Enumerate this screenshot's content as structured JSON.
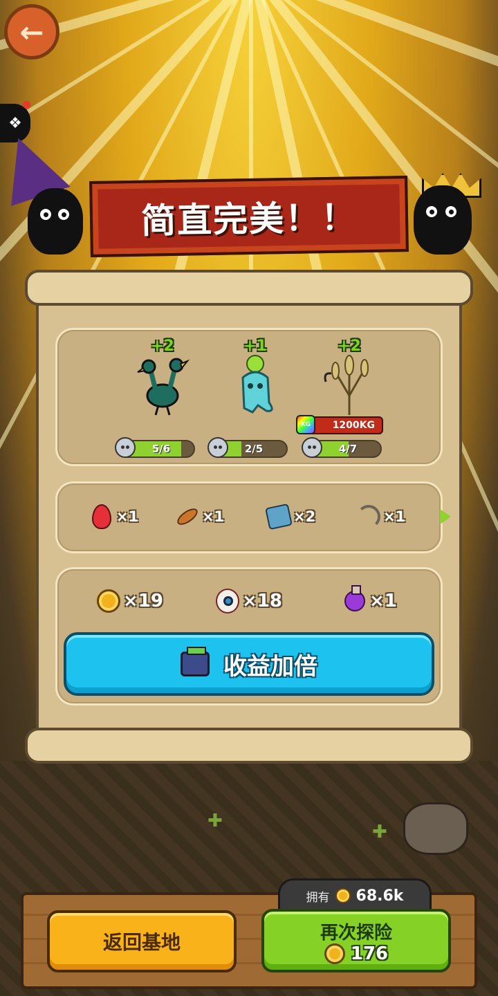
{
  "banner": {
    "title": "简直完美！！"
  },
  "monsters": [
    {
      "name": "ostrich",
      "plus": "+2",
      "progress": "5/6",
      "fill": 0.83,
      "color": "#1f6d5e"
    },
    {
      "name": "ghost-radish",
      "plus": "+1",
      "progress": "2/5",
      "fill": 0.4,
      "color": "#5fd3d8"
    },
    {
      "name": "wheat-plant",
      "plus": "+2",
      "progress": "4/7",
      "fill": 0.57,
      "color": "#b8a46a",
      "weight": "1200KG",
      "weight_tag": "KG"
    }
  ],
  "loot": [
    {
      "icon": "red-egg-icon",
      "qty": "×1"
    },
    {
      "icon": "feather-icon",
      "qty": "×1"
    },
    {
      "icon": "ticket-icon",
      "qty": "×2"
    },
    {
      "icon": "worm-icon",
      "qty": "×1"
    }
  ],
  "rewards": [
    {
      "icon": "coin-icon",
      "qty": "×19"
    },
    {
      "icon": "eyeball-icon",
      "qty": "×18"
    },
    {
      "icon": "potion-icon",
      "qty": "×1"
    }
  ],
  "double_button": {
    "label": "收益加倍",
    "icon": "tv-icon"
  },
  "owned": {
    "label": "拥有",
    "value": "68.6k"
  },
  "buttons": {
    "home": "返回基地",
    "again": "再次探险",
    "again_cost": "176"
  },
  "colors": {
    "accent_blue": "#1ec2ef",
    "accent_green": "#86d125",
    "accent_orange": "#f9b21a",
    "banner_red": "#a82718"
  }
}
